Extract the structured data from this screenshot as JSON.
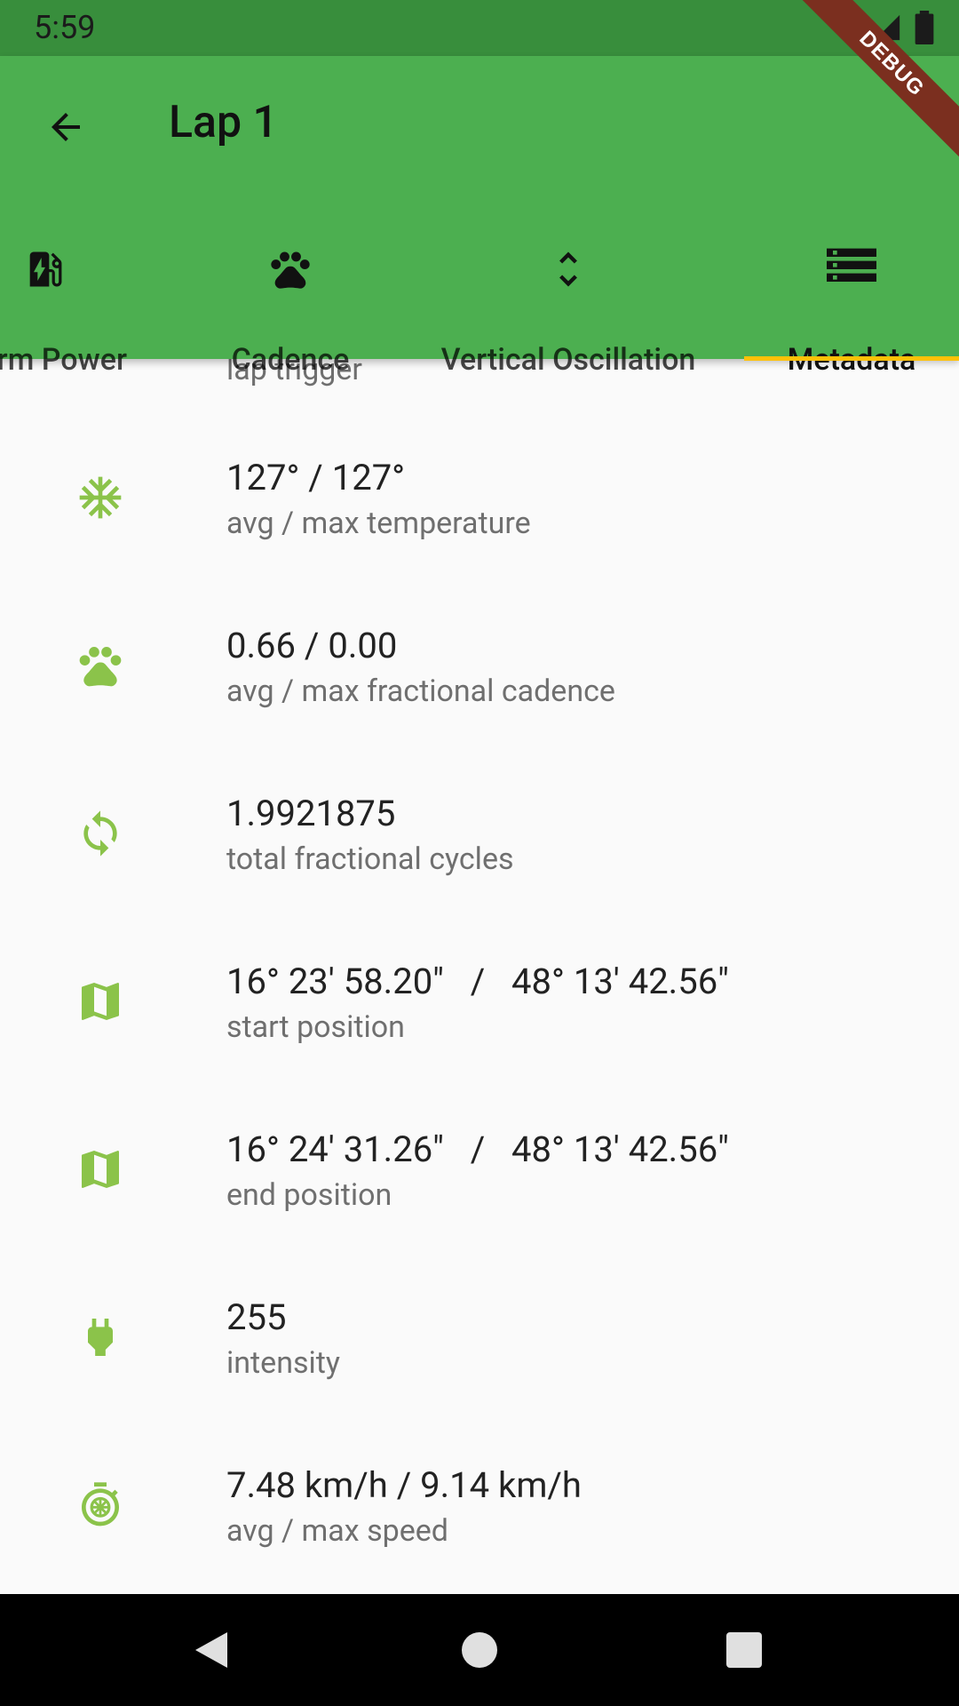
{
  "status_bar": {
    "time": "5:59"
  },
  "app_bar": {
    "title": "Lap 1"
  },
  "tabs": [
    {
      "label": "Form Power",
      "icon": "ev-station-icon"
    },
    {
      "label": "Cadence",
      "icon": "paw-icon"
    },
    {
      "label": "Vertical Oscillation",
      "icon": "unfold-more-icon"
    },
    {
      "label": "Metadata",
      "icon": "storage-icon",
      "active": true
    }
  ],
  "partial_row": {
    "secondary": "lap trigger"
  },
  "rows": [
    {
      "primary": "127° / 127°",
      "secondary": "avg / max temperature",
      "icon": "snowflake-icon"
    },
    {
      "primary": "0.66 / 0.00",
      "secondary": "avg / max fractional cadence",
      "icon": "paw-icon"
    },
    {
      "primary": "1.9921875",
      "secondary": "total fractional cycles",
      "icon": "sync-icon"
    },
    {
      "primary": "16° 23' 58.20\"   /   48° 13' 42.56\"",
      "secondary": "start position",
      "icon": "map-icon"
    },
    {
      "primary": "16° 24' 31.26\"   /   48° 13' 42.56\"",
      "secondary": "end position",
      "icon": "map-icon"
    },
    {
      "primary": "255",
      "secondary": "intensity",
      "icon": "power-plug-icon"
    },
    {
      "primary": "7.48 km/h / 9.14 km/h",
      "secondary": "avg / max speed",
      "icon": "timer-icon"
    }
  ],
  "debug_banner": "DEBUG",
  "colors": {
    "primary": "#4CAF50",
    "primary_dark": "#388E3C",
    "accent": "#FFC107",
    "icon_green": "#8BC34A"
  }
}
